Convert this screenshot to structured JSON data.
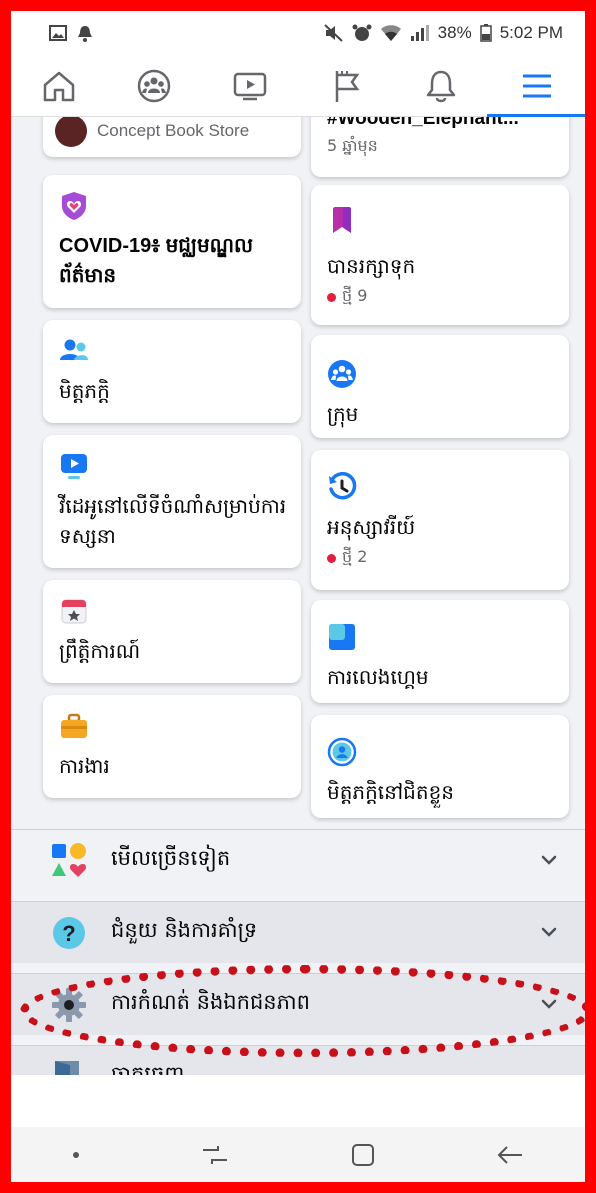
{
  "status_bar": {
    "battery": "38%",
    "time": "5:02 PM"
  },
  "nav": {
    "tabs": [
      "home",
      "groups",
      "watch",
      "pages",
      "notifications",
      "menu"
    ],
    "active": "menu"
  },
  "shortcuts_left": [
    {
      "name": "concept-book-store",
      "label": "Concept Book Store",
      "icon": "store-avatar-icon"
    },
    {
      "name": "covid-19-info-center",
      "label": "COVID-19៖ មជ្ឈមណ្ឌលព័ត៌មាន",
      "icon": "heart-shield-icon"
    },
    {
      "name": "friends",
      "label": "មិត្តភក្តិ",
      "icon": "friends-icon"
    },
    {
      "name": "videos-on-watch",
      "label": "វីដេអូនៅលើទីចំណាំសម្រាប់ការទស្សនា",
      "icon": "play-video-icon"
    },
    {
      "name": "events",
      "label": "ព្រឹត្តិការណ៍",
      "icon": "calendar-star-icon"
    },
    {
      "name": "jobs",
      "label": "ការងារ",
      "icon": "briefcase-icon"
    }
  ],
  "shortcuts_right": [
    {
      "name": "wooden-elephant-post",
      "label": "#Wooden_Elephant...",
      "sub": "5 ឆ្នាំមុន",
      "icon": ""
    },
    {
      "name": "saved",
      "label": "បានរក្សាទុក",
      "sub": "ថ្មី 9",
      "icon": "bookmark-icon",
      "badge_dot": true
    },
    {
      "name": "groups",
      "label": "ក្រុម",
      "icon": "groups-icon"
    },
    {
      "name": "memories",
      "label": "អនុស្សាវរីយ៍",
      "sub": "ថ្មី 2",
      "icon": "clock-history-icon",
      "badge_dot": true
    },
    {
      "name": "gaming",
      "label": "ការលេងហ្គេម",
      "icon": "gaming-icon"
    },
    {
      "name": "nearby-friends",
      "label": "មិត្តភក្តិនៅជិតខ្លួន",
      "icon": "nearby-friends-icon"
    }
  ],
  "menu_rows": [
    {
      "name": "see-more",
      "label": "មើលច្រើនទៀត",
      "icon": "see-more-icon"
    },
    {
      "name": "help-support",
      "label": "ជំនួយ និងការគាំទ្រ",
      "icon": "question-icon"
    },
    {
      "name": "settings-privacy",
      "label": "ការកំណត់ និងឯកជនភាព",
      "icon": "gear-icon"
    },
    {
      "name": "log-out",
      "label": "ចាកចេញ",
      "icon": "door-icon"
    }
  ],
  "colors": {
    "accent": "#1877f2",
    "frame": "#ff0000",
    "highlight": "#c8101a",
    "background": "#f0f2f5"
  }
}
